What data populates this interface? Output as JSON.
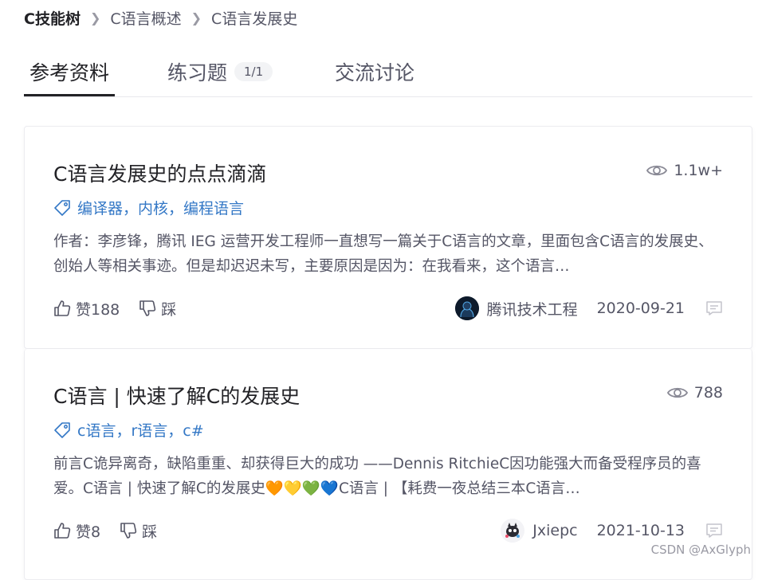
{
  "breadcrumb": {
    "root": "C技能树",
    "level2": "C语言概述",
    "level3": "C语言发展史"
  },
  "tabs": [
    {
      "label": "参考资料",
      "active": true
    },
    {
      "label": "练习题",
      "badge": "1/1"
    },
    {
      "label": "交流讨论"
    }
  ],
  "articles": [
    {
      "title": "C语言发展史的点点滴滴",
      "views": "1.1w+",
      "tags": "编译器，内核，编程语言",
      "summary": "作者：李彦锋，腾讯 IEG 运营开发工程师一直想写一篇关于C语言的文章，里面包含C语言的发展史、创始人等相关事迹。但是却迟迟未写，主要原因是因为：在我看来，这个语言…",
      "likes": "赞188",
      "dislike": "踩",
      "author": "腾讯技术工程",
      "date": "2020-09-21"
    },
    {
      "title": "C语言 | 快速了解C的发展史",
      "views": "788",
      "tags": "c语言，r语言，c#",
      "summary": "前言C诡异离奇，缺陷重重、却获得巨大的成功 ——Dennis RitchieC因功能强大而备受程序员的喜爱。C语言 | 快速了解C的发展史🧡💛💚💙C语言 | 【耗费一夜总结三本C语言…",
      "likes": "赞8",
      "dislike": "踩",
      "author": "Jxiepc",
      "date": "2021-10-13"
    }
  ],
  "watermark": "CSDN @AxGlyph",
  "colors": {
    "tag_blue": "#3478c6",
    "text_primary": "#222226",
    "text_secondary": "#555666"
  }
}
